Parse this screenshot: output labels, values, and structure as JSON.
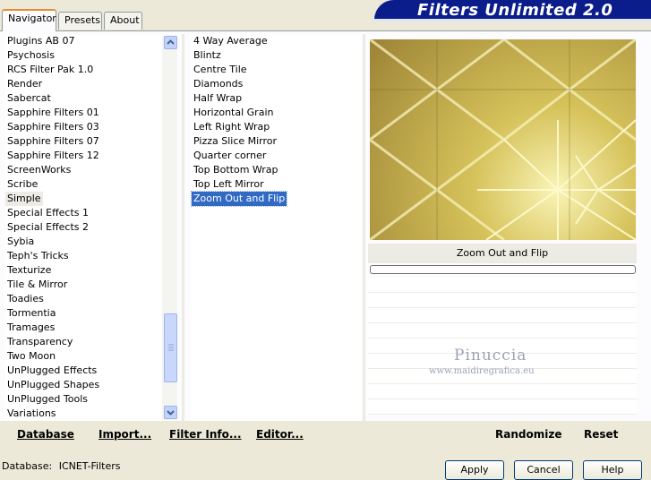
{
  "tabs": [
    {
      "label": "Navigator"
    },
    {
      "label": "Presets"
    },
    {
      "label": "About"
    }
  ],
  "banner": {
    "title": "Filters Unlimited 2.0"
  },
  "categories": [
    "Plugins AB 07",
    "Psychosis",
    "RCS Filter Pak 1.0",
    "Render",
    "Sabercat",
    "Sapphire Filters 01",
    "Sapphire Filters 03",
    "Sapphire Filters 07",
    "Sapphire Filters 12",
    "ScreenWorks",
    "Scribe",
    "Simple",
    "Special Effects 1",
    "Special Effects 2",
    "Sybia",
    "Teph's Tricks",
    "Texturize",
    "Tile & Mirror",
    "Toadies",
    "Tormentia",
    "Tramages",
    "Transparency",
    "Two Moon",
    "UnPlugged Effects",
    "UnPlugged Shapes",
    "UnPlugged Tools",
    "Variations"
  ],
  "selected_category": "Simple",
  "filters": [
    "4 Way Average",
    "Blintz",
    "Centre Tile",
    "Diamonds",
    "Half Wrap",
    "Horizontal Grain",
    "Left Right Wrap",
    "Pizza Slice Mirror",
    "Quarter corner",
    "Top Bottom Wrap",
    "Top Left Mirror",
    "Zoom Out and Flip"
  ],
  "selected_filter": "Zoom Out and Flip",
  "preview": {
    "filter_name": "Zoom Out and Flip",
    "watermark_name": "Pinuccia",
    "watermark_url": "www.maidiregrafica.eu"
  },
  "toolbar": {
    "database": "Database",
    "import": "Import...",
    "filter_info": "Filter Info...",
    "editor": "Editor...",
    "randomize": "Randomize",
    "reset": "Reset"
  },
  "status": {
    "database_label": "Database:",
    "database_value": "ICNET-Filters"
  },
  "buttons": {
    "apply": "Apply",
    "cancel": "Cancel",
    "help": "Help"
  },
  "colors": {
    "banner": "#0a1d8a",
    "selection": "#316ac5",
    "tab_highlight": "#e68b2c"
  }
}
